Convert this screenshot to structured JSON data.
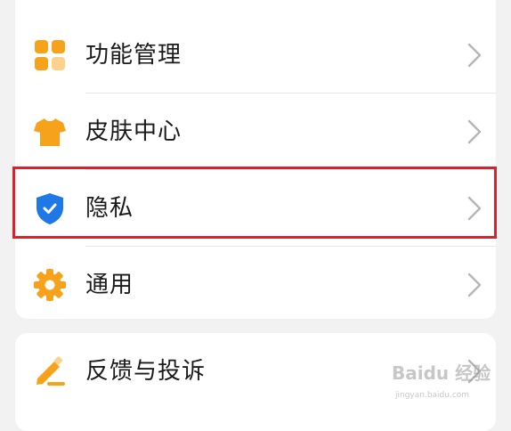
{
  "settings": {
    "items": [
      {
        "label": "功能管理",
        "icon": "feature-grid-icon"
      },
      {
        "label": "皮肤中心",
        "icon": "shirt-icon"
      },
      {
        "label": "隐私",
        "icon": "shield-check-icon"
      },
      {
        "label": "通用",
        "icon": "gear-icon"
      }
    ],
    "feedback": {
      "label": "反馈与投诉",
      "icon": "pencil-icon"
    }
  },
  "colors": {
    "background": "#f2f2f2",
    "card": "#ffffff",
    "icon_orange": "#f7a21b",
    "icon_blue": "#1e78e6",
    "chevron": "#b5b5b5",
    "highlight": "#d8232a"
  },
  "watermark": {
    "text": "Baidu 经验",
    "url_text": "jingyan.baidu.com"
  }
}
